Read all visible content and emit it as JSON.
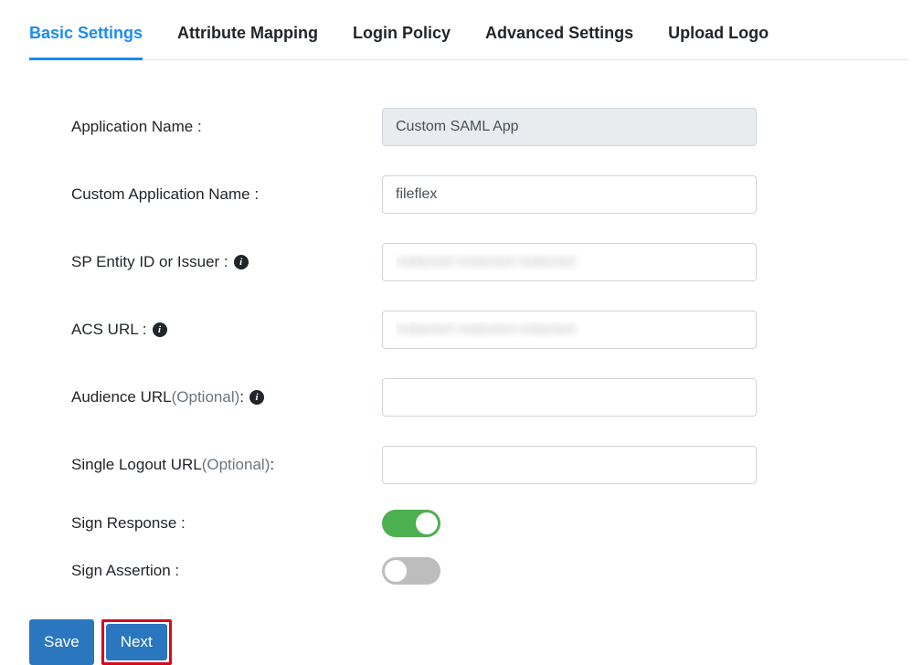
{
  "tabs": {
    "basic_settings": "Basic Settings",
    "attribute_mapping": "Attribute Mapping",
    "login_policy": "Login Policy",
    "advanced_settings": "Advanced Settings",
    "upload_logo": "Upload Logo"
  },
  "form": {
    "application_name": {
      "label": "Application Name :",
      "value": "Custom SAML App"
    },
    "custom_application_name": {
      "label": "Custom Application Name :",
      "value": "fileflex"
    },
    "sp_entity_id": {
      "label": "SP Entity ID or Issuer :",
      "value": ""
    },
    "acs_url": {
      "label": "ACS URL :",
      "value": ""
    },
    "audience_url": {
      "label_pre": "Audience URL ",
      "label_optional": "(Optional)",
      "label_post": " :",
      "value": ""
    },
    "single_logout_url": {
      "label_pre": "Single Logout URL ",
      "label_optional": "(Optional)",
      "label_post": " :",
      "value": ""
    },
    "sign_response": {
      "label": "Sign Response :",
      "on": true
    },
    "sign_assertion": {
      "label": "Sign Assertion :",
      "on": false
    }
  },
  "buttons": {
    "save": "Save",
    "next": "Next"
  },
  "info_glyph": "i"
}
